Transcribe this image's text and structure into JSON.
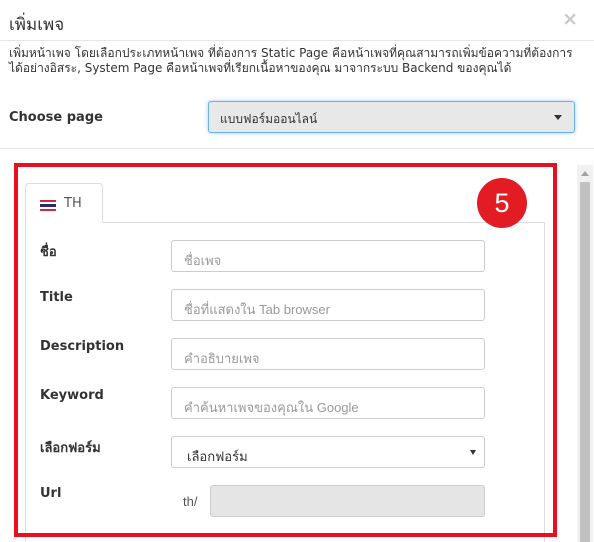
{
  "modal": {
    "title": "เพิ่มเพจ",
    "close_label": "×",
    "description": "เพิ่มหน้าเพจ โดยเลือกประเภทหน้าเพจ ที่ต้องการ Static Page คือหน้าเพจที่คุณสามารถเพิ่มข้อความที่ต้องการได้อย่างอิสระ, System Page คือหน้าเพจที่เรียกเนื้อหาของคุณ มาจากระบบ Backend ของคุณได้"
  },
  "choose_page": {
    "label": "Choose page",
    "selected": "แบบฟอร์มออนไลน์"
  },
  "language_tab": {
    "label": "TH",
    "flag_icon": "thai-flag-icon"
  },
  "callout": {
    "number": "5",
    "color": "#e31b23"
  },
  "form": {
    "name": {
      "label": "ชื่อ",
      "placeholder": "ชื่อเพจ"
    },
    "title": {
      "label": "Title",
      "placeholder": "ชื่อที่แสดงใน Tab browser"
    },
    "description": {
      "label": "Description",
      "placeholder": "คำอธิบายเพจ"
    },
    "keyword": {
      "label": "Keyword",
      "placeholder": "คำค้นหาเพจของคุณใน Google"
    },
    "form_select": {
      "label": "เลือกฟอร์ม",
      "selected": "เลือกฟอร์ม"
    },
    "url": {
      "label": "Url",
      "prefix": "th/",
      "value": ""
    }
  },
  "colors": {
    "highlight_frame": "#e8101e",
    "focus_border": "#66afe9"
  }
}
